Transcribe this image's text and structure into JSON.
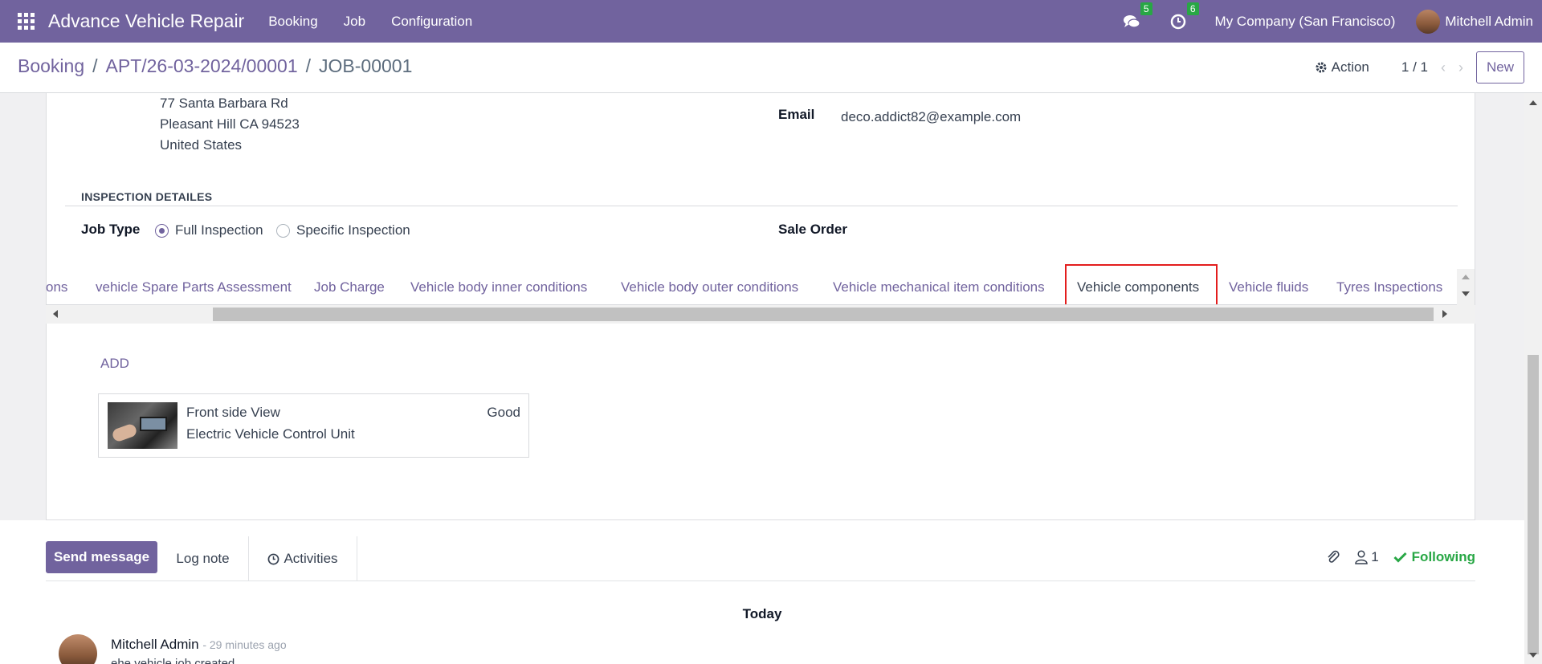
{
  "navbar": {
    "app_title": "Advance Vehicle Repair",
    "menu": [
      "Booking",
      "Job",
      "Configuration"
    ],
    "messages_count": "5",
    "activities_count": "6",
    "company": "My Company (San Francisco)",
    "user": "Mitchell Admin"
  },
  "control": {
    "breadcrumb": [
      "Booking",
      "APT/26-03-2024/00001",
      "JOB-00001"
    ],
    "breadcrumb_sep": "/",
    "action_label": "Action",
    "pager": "1 / 1",
    "new_label": "New"
  },
  "form": {
    "address": [
      "77 Santa Barbara Rd",
      "Pleasant Hill CA 94523",
      "United States"
    ],
    "email_label": "Email",
    "email_value": "deco.addict82@example.com",
    "section_title": "INSPECTION DETAILES",
    "job_type_label": "Job Type",
    "job_type_options": [
      "Full Inspection",
      "Specific Inspection"
    ],
    "job_type_selected": "Full Inspection",
    "sale_order_label": "Sale Order"
  },
  "tabs": [
    "ons",
    "vehicle Spare Parts Assessment",
    "Job Charge",
    "Vehicle body inner conditions",
    "Vehicle body outer conditions",
    "Vehicle mechanical item conditions",
    "Vehicle components",
    "Vehicle fluids",
    "Tyres Inspections"
  ],
  "active_tab": "Vehicle components",
  "components": {
    "add_label": "ADD",
    "items": [
      {
        "title": "Front side View",
        "subtitle": "Electric Vehicle Control Unit",
        "status": "Good"
      }
    ]
  },
  "chatter": {
    "send_message": "Send message",
    "log_note": "Log note",
    "activities": "Activities",
    "followers_count": "1",
    "following": "Following",
    "date_separator": "Today",
    "message": {
      "author": "Mitchell Admin",
      "time": "- 29 minutes ago",
      "body": "ehe vehicle job created"
    }
  },
  "colors": {
    "brand": "#71639e",
    "highlight": "#e31d1d",
    "success": "#28a745"
  }
}
